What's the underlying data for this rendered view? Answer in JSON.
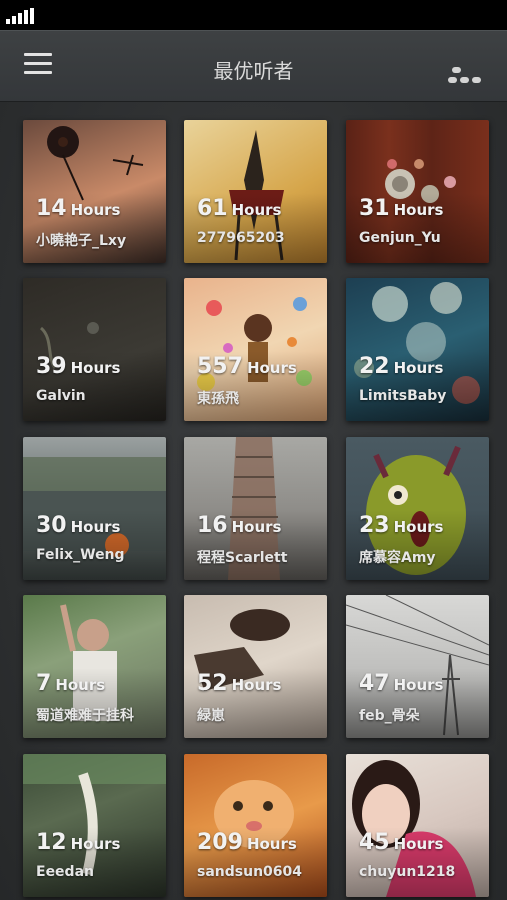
{
  "header": {
    "title": "最优听者"
  },
  "tiles": [
    {
      "hours": "14",
      "unit": "Hours",
      "name": "小曉艳子_Lxy"
    },
    {
      "hours": "61",
      "unit": "Hours",
      "name": "277965203"
    },
    {
      "hours": "31",
      "unit": "Hours",
      "name": "Genjun_Yu"
    },
    {
      "hours": "39",
      "unit": "Hours",
      "name": "Galvin"
    },
    {
      "hours": "557",
      "unit": "Hours",
      "name": "東孫飛"
    },
    {
      "hours": "22",
      "unit": "Hours",
      "name": "LimitsBaby"
    },
    {
      "hours": "30",
      "unit": "Hours",
      "name": "Felix_Weng"
    },
    {
      "hours": "16",
      "unit": "Hours",
      "name": "程程Scarlett"
    },
    {
      "hours": "23",
      "unit": "Hours",
      "name": "席慕容Amy"
    },
    {
      "hours": "7",
      "unit": "Hours",
      "name": "蜀道难难于挂科"
    },
    {
      "hours": "52",
      "unit": "Hours",
      "name": "緑崽"
    },
    {
      "hours": "47",
      "unit": "Hours",
      "name": "feb_骨朵"
    },
    {
      "hours": "12",
      "unit": "Hours",
      "name": "Eeedan"
    },
    {
      "hours": "209",
      "unit": "Hours",
      "name": "sandsun0604"
    },
    {
      "hours": "45",
      "unit": "Hours",
      "name": "chuyun1218"
    }
  ]
}
